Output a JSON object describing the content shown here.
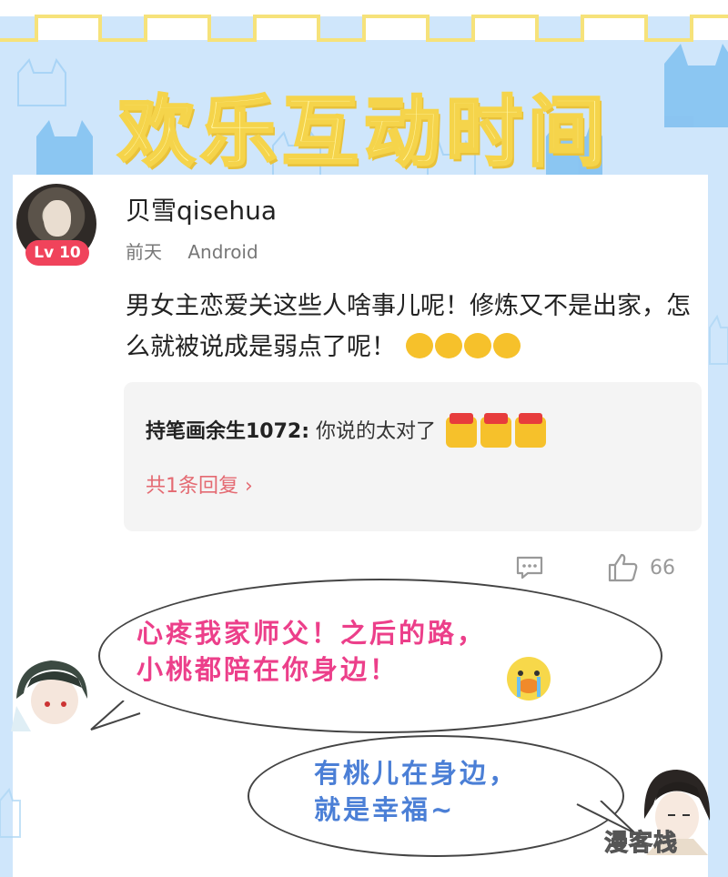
{
  "header": {
    "title": "欢乐互动时间"
  },
  "comment": {
    "username": "贝雪qisehua",
    "level_badge": "Lv 10",
    "time": "前天",
    "device": "Android",
    "text": "男女主恋爱关这些人啥事儿呢！修炼又不是出家，怎么就被说成是弱点了呢！",
    "reply": {
      "author": "持笔画余生1072:",
      "text": "你说的太对了",
      "more_replies": "共1条回复 ›"
    },
    "likes": "66"
  },
  "dialogue": {
    "bubble1_line1": "心疼我家师父！之后的路，",
    "bubble1_line2": "小桃都陪在你身边！",
    "bubble2_line1": "有桃儿在身边，",
    "bubble2_line2": "就是幸福~"
  },
  "watermark": "漫客栈",
  "colors": {
    "background": "#cfe6fb",
    "title_fill": "#fff5a3",
    "level_badge": "#f0435b",
    "bubble1_text": "#ec3f8a",
    "bubble2_text": "#4b7fd6",
    "reply_link": "#e46a72"
  }
}
